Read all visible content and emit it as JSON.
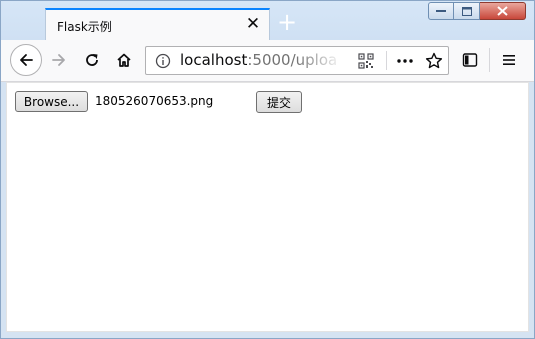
{
  "window": {
    "tab_title": "Flask示例",
    "tab_close_glyph": "✕",
    "new_tab_glyph": "+"
  },
  "navbar": {
    "url_host": "localhost",
    "url_rest": ":5000/uploa",
    "icons": [
      "back-arrow-icon",
      "forward-arrow-icon",
      "reload-icon",
      "home-icon",
      "info-icon",
      "qr-code-icon",
      "more-dots-icon",
      "bookmark-star-icon",
      "sidebar-icon",
      "hamburger-menu-icon"
    ]
  },
  "page": {
    "browse_label": "Browse...",
    "file_name": "180526070653.png",
    "submit_label": "提交"
  },
  "colors": {
    "accent": "#0a84ff",
    "frame": "#d5e3f2",
    "toolbar": "#f9f9fa"
  }
}
